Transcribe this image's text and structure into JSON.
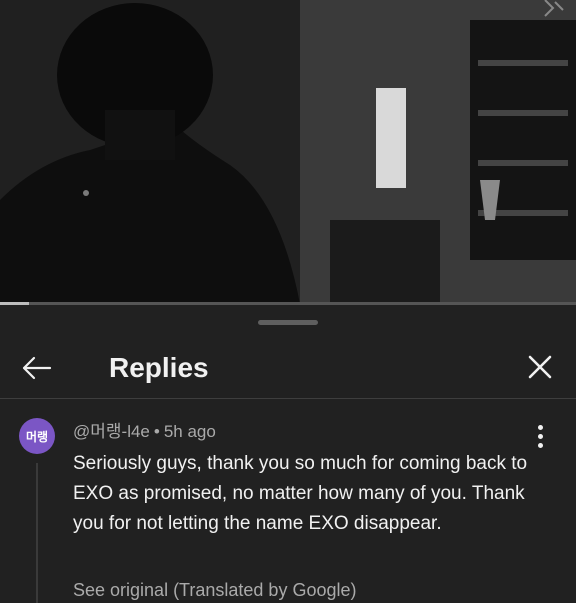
{
  "video": {
    "progress_fraction": 0.05,
    "watermark_icon": "channel-logo-icon"
  },
  "sheet": {
    "title": "Replies",
    "back_icon": "back-arrow-icon",
    "close_icon": "close-icon"
  },
  "comment": {
    "avatar_text": "머랭",
    "avatar_color": "#7b56c5",
    "author": "@머랭-l4e",
    "separator": "•",
    "time": "5h ago",
    "text": "Seriously guys, thank you so much for coming back to EXO as promised, no matter how many of you. Thank you for not letting the name EXO disappear.",
    "see_original": "See original (Translated by Google)",
    "menu_icon": "more-vert-icon"
  }
}
